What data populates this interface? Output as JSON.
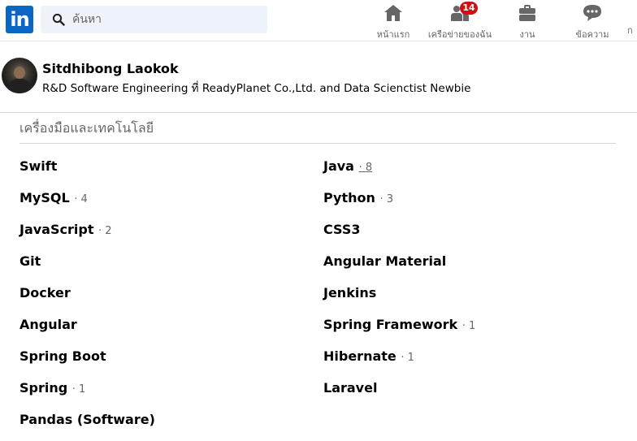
{
  "nav": {
    "logo_text": "in",
    "search_placeholder": "ค้นหา",
    "items": [
      {
        "label": "หน้าแรก",
        "icon": "home-icon"
      },
      {
        "label": "เครือข่ายของฉัน",
        "icon": "network-icon",
        "badge": "14"
      },
      {
        "label": "งาน",
        "icon": "briefcase-icon"
      },
      {
        "label": "ข้อความ",
        "icon": "messaging-icon"
      },
      {
        "label": "ก"
      }
    ]
  },
  "profile": {
    "name": "Sitdhibong Laokok",
    "headline": "R&D Software Engineering ที่ ReadyPlanet Co.,Ltd. and Data Scienctist Newbie"
  },
  "section": {
    "title": "เครื่องมือและเทคโนโลยี",
    "skills": [
      {
        "name": "Swift",
        "count": ""
      },
      {
        "name": "Java",
        "count": "· 8"
      },
      {
        "name": "MySQL",
        "count": "· 4"
      },
      {
        "name": "Python",
        "count": "· 3"
      },
      {
        "name": "JavaScript",
        "count": "· 2"
      },
      {
        "name": "CSS3",
        "count": ""
      },
      {
        "name": "Git",
        "count": ""
      },
      {
        "name": "Angular Material",
        "count": ""
      },
      {
        "name": "Docker",
        "count": ""
      },
      {
        "name": "Jenkins",
        "count": ""
      },
      {
        "name": "Angular",
        "count": ""
      },
      {
        "name": "Spring Framework",
        "count": "· 1"
      },
      {
        "name": "Spring Boot",
        "count": ""
      },
      {
        "name": "Hibernate",
        "count": "· 1"
      },
      {
        "name": "Spring",
        "count": "· 1"
      },
      {
        "name": "Laravel",
        "count": ""
      },
      {
        "name": "Pandas (Software)",
        "count": ""
      }
    ]
  },
  "colors": {
    "brand": "#0a66c2",
    "badge": "#cc1016",
    "muted_text": "#666666"
  }
}
